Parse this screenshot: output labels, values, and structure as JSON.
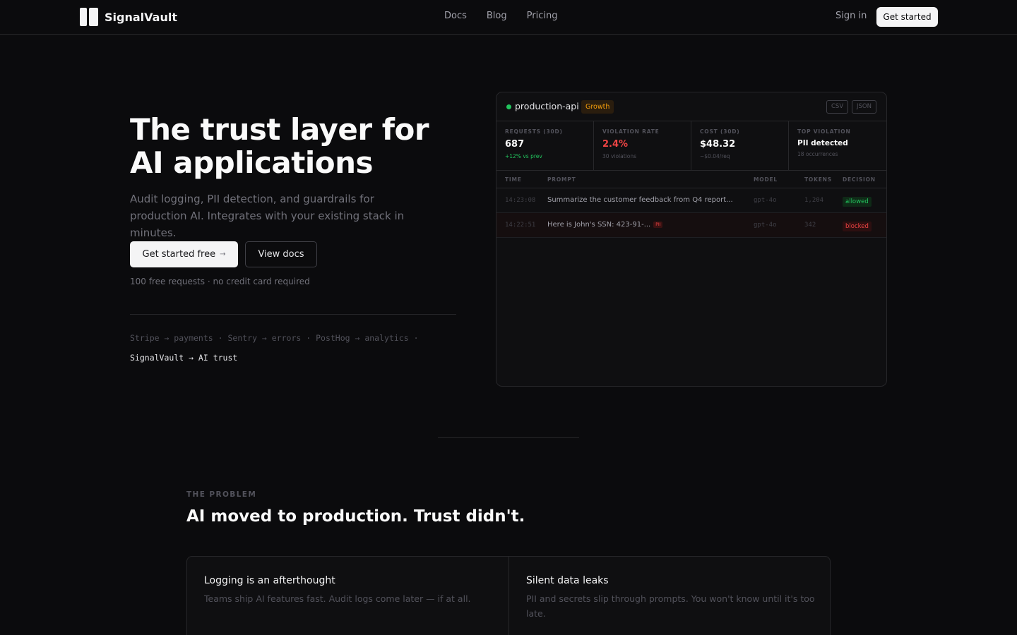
{
  "brand": {
    "name": "SignalVault"
  },
  "nav": {
    "links": [
      "Docs",
      "Blog",
      "Pricing"
    ],
    "signin": "Sign in",
    "cta": "Get started"
  },
  "hero": {
    "title": "The trust layer for AI applications",
    "subtitle": "Audit logging, PII detection, and guardrails for production AI. Integrates with your existing stack in minutes.",
    "primary_cta": "Get started free",
    "primary_arrow": "→",
    "secondary_cta": "View docs",
    "note": "100 free requests · no credit card required",
    "stack_line_1": "Stripe → payments · Sentry → errors · PostHog → analytics ·",
    "stack_line_2": "SignalVault → AI trust"
  },
  "dashboard": {
    "project": "production-api",
    "plan": "Growth",
    "exports": [
      "CSV",
      "JSON"
    ],
    "stats": [
      {
        "label": "REQUESTS (30D)",
        "value": "687",
        "sub": "+12% vs prev"
      },
      {
        "label": "VIOLATION RATE",
        "value": "2.4%",
        "sub": "30 violations"
      },
      {
        "label": "COST (30D)",
        "value": "$48.32",
        "sub": "~$0.04/req"
      },
      {
        "label": "TOP VIOLATION",
        "value": "PII detected",
        "sub": "18 occurrences"
      }
    ],
    "columns": [
      "TIME",
      "PROMPT",
      "MODEL",
      "TOKENS",
      "DECISION"
    ],
    "rows": [
      {
        "time": "14:23:08",
        "prompt": "Summarize the customer feedback from Q4 report...",
        "tag": "",
        "model": "gpt-4o",
        "tokens": "1,204",
        "decision": "allowed"
      },
      {
        "time": "14:22:51",
        "prompt": "Here is John's SSN: 423-91-...",
        "tag": "PII",
        "model": "gpt-4o",
        "tokens": "342",
        "decision": "blocked"
      }
    ],
    "colors": {
      "ok": "#22c55e",
      "danger": "#ef4444",
      "plan": "#f59e0b"
    }
  },
  "problem": {
    "eyebrow": "THE PROBLEM",
    "title": "AI moved to production. Trust didn't.",
    "cards": [
      {
        "title": "Logging is an afterthought",
        "desc": "Teams ship AI features fast. Audit logs come later — if at all."
      },
      {
        "title": "Silent data leaks",
        "desc": "PII and secrets slip through prompts. You won't know until it's too late."
      }
    ]
  }
}
